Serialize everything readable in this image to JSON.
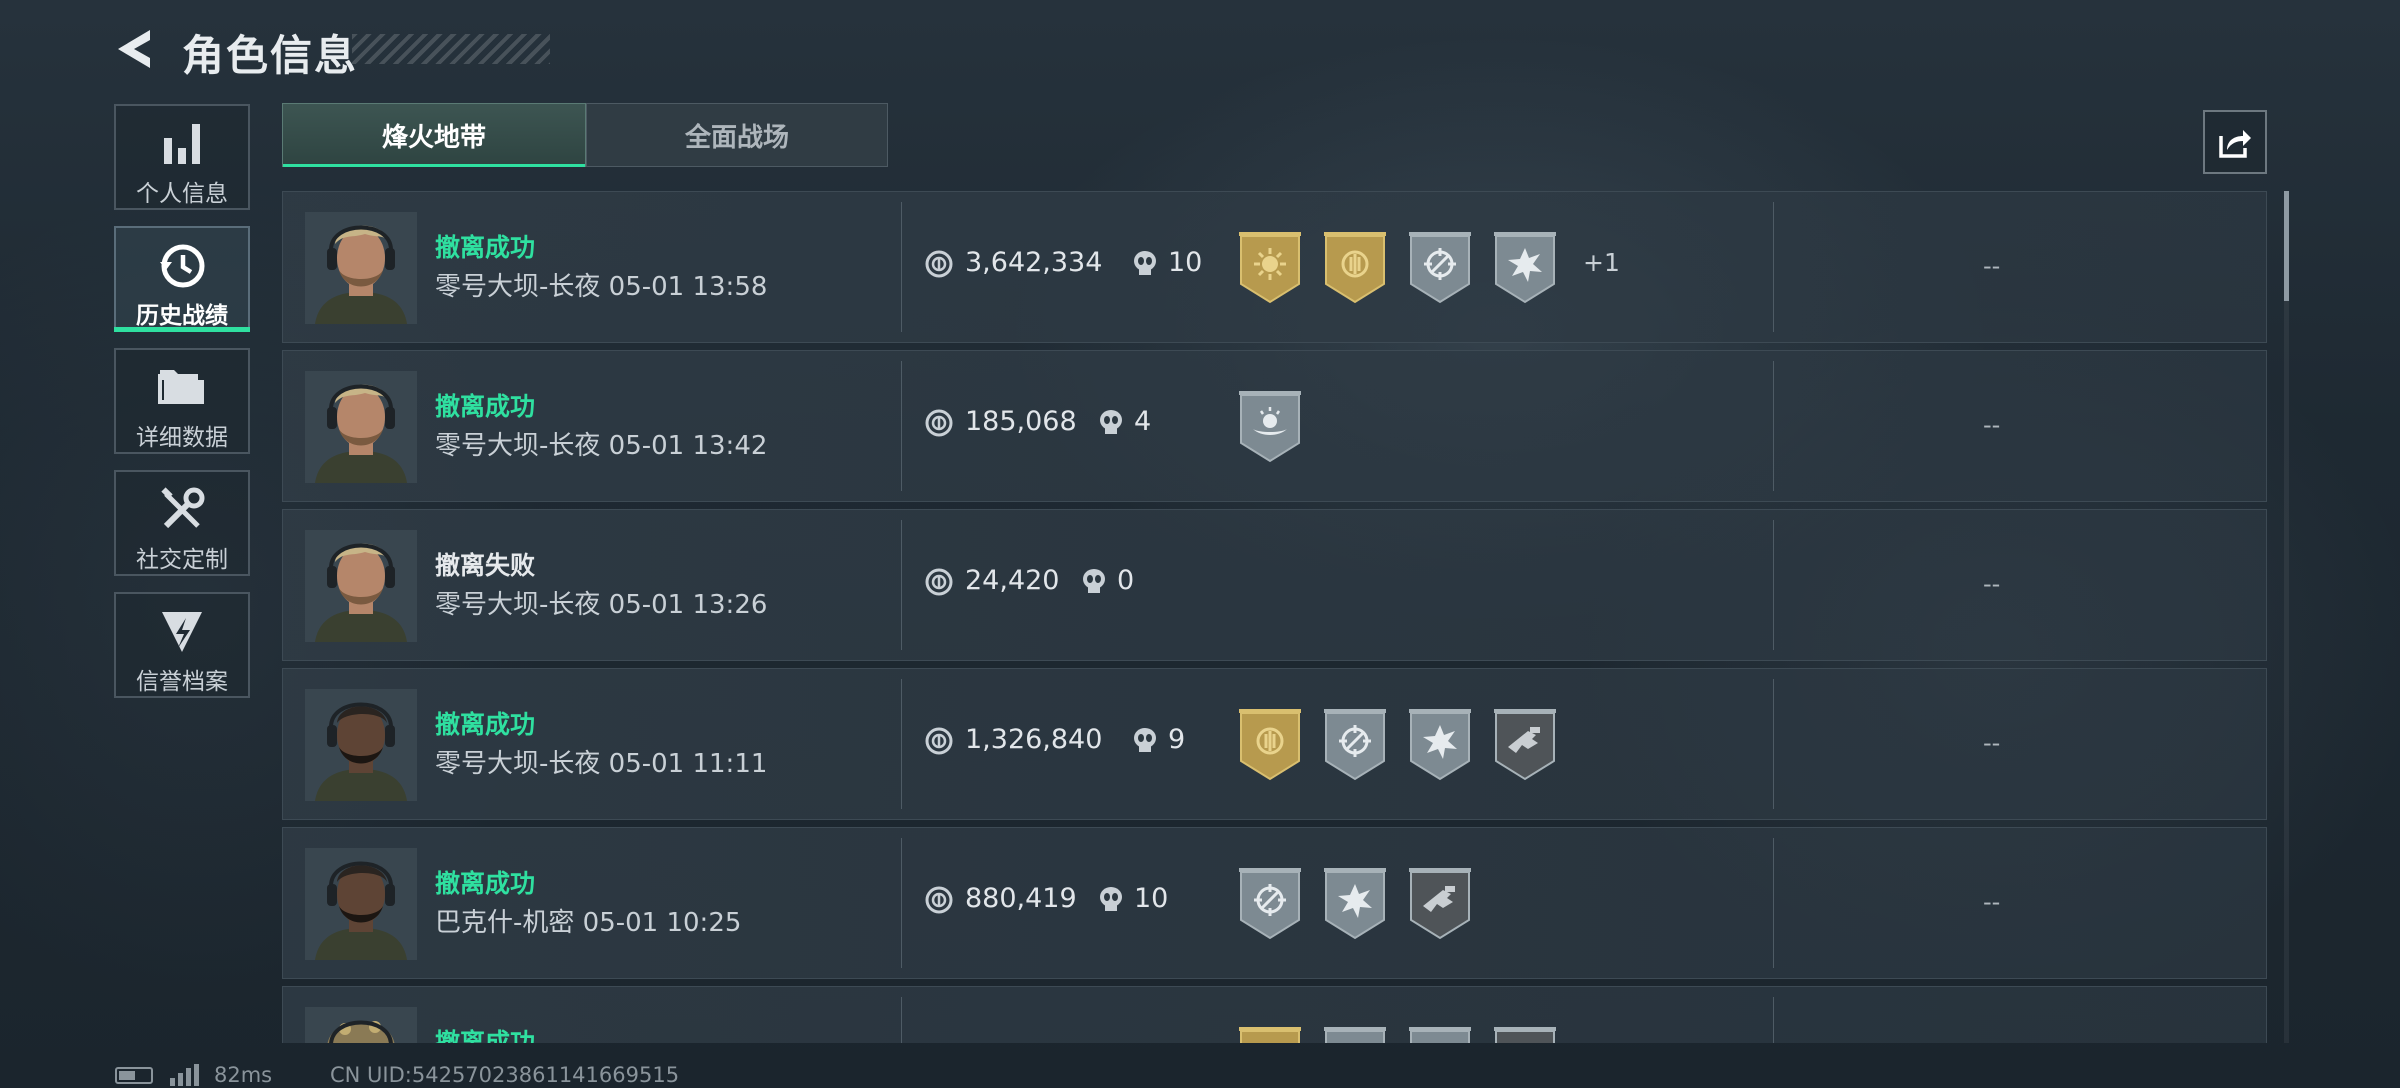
{
  "header": {
    "title": "角色信息"
  },
  "sidebar": {
    "items": [
      {
        "label": "个人信息",
        "icon": "bar-chart-icon"
      },
      {
        "label": "历史战绩",
        "icon": "history-clock-icon",
        "active": true
      },
      {
        "label": "详细数据",
        "icon": "folder-icon"
      },
      {
        "label": "社交定制",
        "icon": "tools-icon"
      },
      {
        "label": "信誉档案",
        "icon": "shield-badge-icon"
      }
    ]
  },
  "tabs": [
    {
      "label": "烽火地带",
      "active": true
    },
    {
      "label": "全面战场",
      "active": false
    }
  ],
  "share": {
    "icon": "share-icon"
  },
  "records": [
    {
      "status": "撤离成功",
      "success": true,
      "map": "零号大坝-长夜",
      "time": "05-01 13:58",
      "value": "3,642,334",
      "kills": "10",
      "badges": [
        "gold-sun-badge-icon",
        "gold-emblem-badge-icon",
        "crosshair-badge-icon",
        "explosion-badge-icon"
      ],
      "extra": "+1",
      "right": "--",
      "avatar": "blond"
    },
    {
      "status": "撤离成功",
      "success": true,
      "map": "零号大坝-长夜",
      "time": "05-01 13:42",
      "value": "185,068",
      "kills": "4",
      "badges": [
        "hand-orb-badge-icon"
      ],
      "extra": "",
      "right": "--",
      "avatar": "blond"
    },
    {
      "status": "撤离失败",
      "success": false,
      "map": "零号大坝-长夜",
      "time": "05-01 13:26",
      "value": "24,420",
      "kills": "0",
      "badges": [],
      "extra": "",
      "right": "--",
      "avatar": "blond"
    },
    {
      "status": "撤离成功",
      "success": true,
      "map": "零号大坝-长夜",
      "time": "05-01 11:11",
      "value": "1,326,840",
      "kills": "9",
      "badges": [
        "gold-emblem-badge-icon",
        "crosshair-badge-icon",
        "explosion-badge-icon",
        "weapon-dark-badge-icon"
      ],
      "extra": "",
      "right": "--",
      "avatar": "bald"
    },
    {
      "status": "撤离成功",
      "success": true,
      "map": "巴克什-机密",
      "time": "05-01 10:25",
      "value": "880,419",
      "kills": "10",
      "badges": [
        "crosshair-badge-icon",
        "explosion-badge-icon",
        "weapon-dark-badge-icon"
      ],
      "extra": "",
      "right": "--",
      "avatar": "bald"
    },
    {
      "status": "撤离成功",
      "success": true,
      "map": "",
      "time": "",
      "value": "",
      "kills": "",
      "badges": [
        "gold-emblem-badge-icon",
        "crosshair-badge-icon",
        "explosion-badge-icon",
        "weapon-dark-badge-icon"
      ],
      "extra": "",
      "right": "",
      "avatar": "helmet"
    }
  ],
  "footer": {
    "latency": "82ms",
    "uid": "CN UID:54257023861141669515"
  },
  "colors": {
    "accent": "#2fe0a0",
    "gold": "#b79a4e",
    "silver": "#77848c"
  }
}
